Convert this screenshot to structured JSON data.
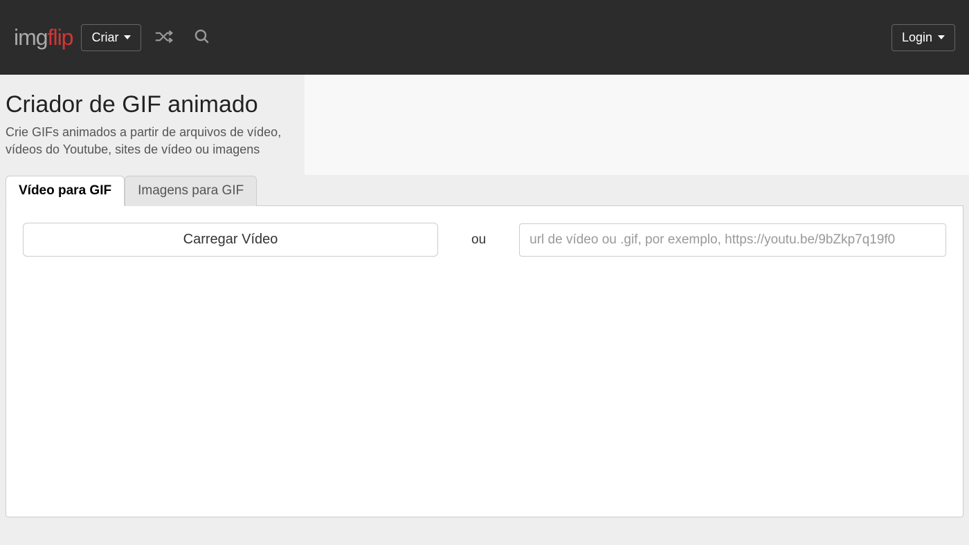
{
  "header": {
    "logo_part1": "img",
    "logo_part2": "flip",
    "create_button": "Criar",
    "login_button": "Login"
  },
  "page": {
    "title": "Criador de GIF animado",
    "subtitle": "Crie GIFs animados a partir de arquivos de vídeo, vídeos do Youtube, sites de vídeo ou imagens"
  },
  "tabs": {
    "video_to_gif": "Vídeo para GIF",
    "images_to_gif": "Imagens para GIF"
  },
  "upload": {
    "button_label": "Carregar Vídeo",
    "or_text": "ou",
    "url_placeholder": "url de vídeo ou .gif, por exemplo, https://youtu.be/9bZkp7q19f0"
  }
}
